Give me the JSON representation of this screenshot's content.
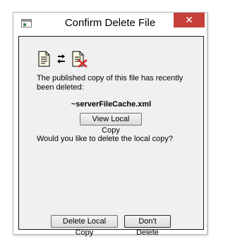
{
  "window": {
    "title": "Confirm Delete File",
    "close_glyph": "✕",
    "app_icon": "application-window-icon"
  },
  "dialog": {
    "icons": [
      "document-icon",
      "sync-arrows-icon",
      "deleted-document-icon"
    ],
    "message": "The published copy of this file has recently been deleted:",
    "filename": "~serverFileCache.xml",
    "view_button": "View Local Copy",
    "question": "Would you like to delete the local copy?",
    "delete_button": "Delete Local Copy",
    "dont_delete_button": "Don't Delete"
  },
  "colors": {
    "close_button": "#c7403a",
    "client_background": "#f0f0f0",
    "delete_x": "#cc2a2a"
  }
}
